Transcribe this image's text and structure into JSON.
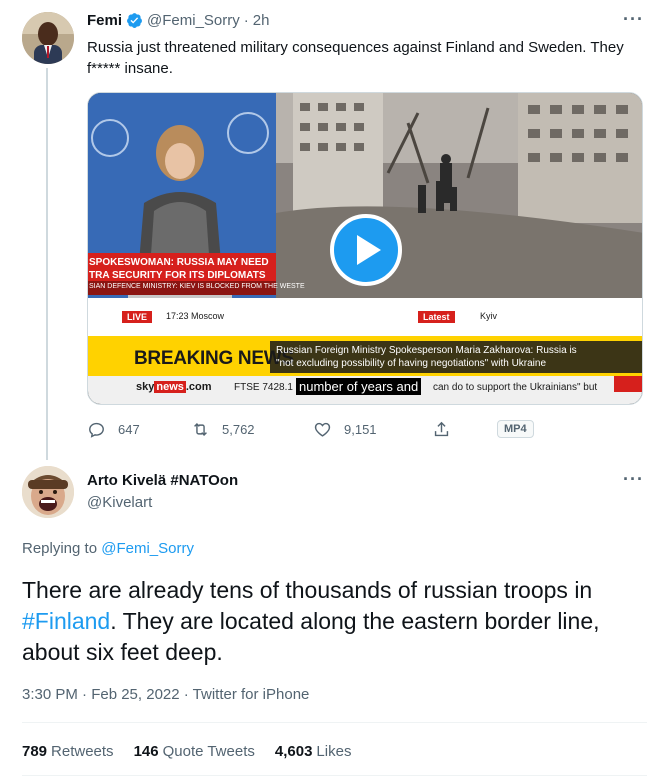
{
  "parent_tweet": {
    "author_name": "Femi",
    "handle": "@Femi_Sorry",
    "separator": "·",
    "time": "2h",
    "more": "···",
    "text": "Russia just threatened military consequences against Finland and Sweden. They f***** insane.",
    "media": {
      "speaker_line1": "SPOKESWOMAN: RUSSIA MAY NEED",
      "speaker_line2": "TRA SECURITY FOR ITS DIPLOMATS",
      "ticker_top": "SIAN DEFENCE MINISTRY: KIEV IS BLOCKED FROM THE WESTE",
      "live_badge": "LIVE",
      "live_time": "17:23 Moscow",
      "latest_badge": "Latest",
      "latest_place": "Kyiv",
      "breaking": "BREAKING NEWS",
      "story_line1": "Russian Foreign Ministry Spokesperson Maria Zakharova: Russia is",
      "story_line2": "\"not excluding possibility of having negotiations\" with Ukraine",
      "sky": "sky",
      "sky_news": "news",
      "sky_com": ".com",
      "ftse": "FTSE 7428.1",
      "caption": "number of years and",
      "ticker_bottom": "can do to support the Ukrainians\" but",
      "play_icon": "play-icon"
    },
    "stats": {
      "replies": "647",
      "retweets": "5,762",
      "likes": "9,151",
      "media_badge": "MP4"
    }
  },
  "main_tweet": {
    "author_name": "Arto Kivelä #NATOon",
    "handle": "@Kivelart",
    "more": "···",
    "replying_prefix": "Replying to ",
    "replying_to": "@Femi_Sorry",
    "text_before": "There are already tens of thousands of russian troops in ",
    "hashtag": "#Finland",
    "text_after": ". They are located along the eastern border line, about six feet deep.",
    "meta": "3:30 PM · Feb 25, 2022 · Twitter for iPhone",
    "retweets_count": "789",
    "retweets_label": "Retweets",
    "quotes_count": "146",
    "quotes_label": "Quote Tweets",
    "likes_count": "4,603",
    "likes_label": "Likes"
  },
  "colors": {
    "accent": "#1d9bf0",
    "muted": "#536471",
    "text": "#0f1419",
    "breaking_yellow": "#ffd200",
    "sky_red": "#d6201c"
  }
}
